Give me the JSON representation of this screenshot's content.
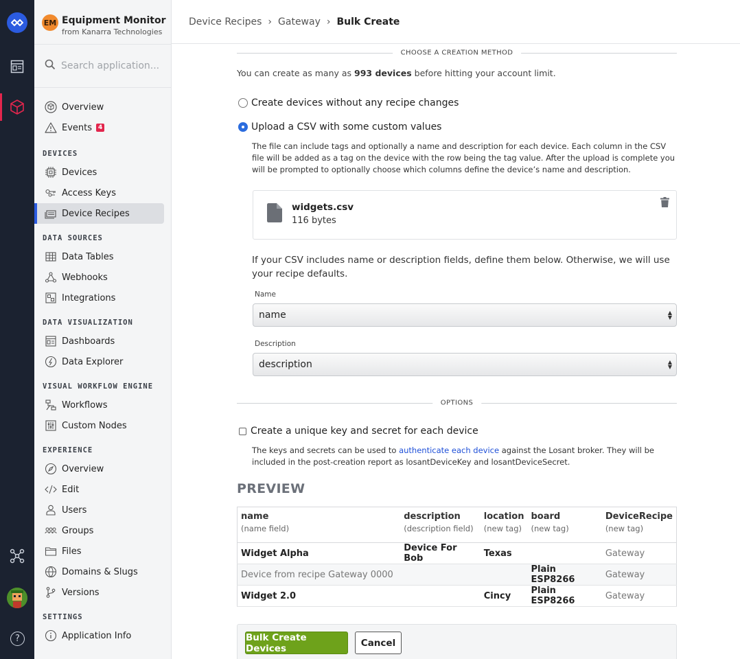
{
  "colors": {
    "rail_bg": "#1b2230",
    "accent_blue": "#2b5be0",
    "alert_red": "#e2264d",
    "primary_green": "#6ea21b",
    "app_badge": "#f18a2d"
  },
  "rail": {
    "icons": [
      "losant-logo-icon",
      "dashboard-icon",
      "cube-icon",
      "workflow-nodes-icon",
      "user-avatar",
      "help-icon"
    ],
    "help_glyph": "?"
  },
  "app": {
    "initials": "EM",
    "name": "Equipment Monitor",
    "org": "from Kanarra Technologies"
  },
  "search": {
    "placeholder": "Search application..."
  },
  "nav": {
    "top": [
      {
        "label": "Overview",
        "icon": "cube-outline-icon"
      },
      {
        "label": "Events",
        "icon": "warning-icon",
        "badge": "4"
      }
    ],
    "devices": {
      "title": "DEVICES",
      "items": [
        {
          "label": "Devices",
          "icon": "chip-icon"
        },
        {
          "label": "Access Keys",
          "icon": "keys-icon"
        },
        {
          "label": "Device Recipes",
          "icon": "recipe-icon",
          "active": true
        }
      ]
    },
    "data_sources": {
      "title": "DATA SOURCES",
      "items": [
        {
          "label": "Data Tables",
          "icon": "table-icon"
        },
        {
          "label": "Webhooks",
          "icon": "webhook-icon"
        },
        {
          "label": "Integrations",
          "icon": "integrations-icon"
        }
      ]
    },
    "data_viz": {
      "title": "DATA VISUALIZATION",
      "items": [
        {
          "label": "Dashboards",
          "icon": "dashboard-icon"
        },
        {
          "label": "Data Explorer",
          "icon": "explorer-icon"
        }
      ]
    },
    "workflow": {
      "title": "VISUAL WORKFLOW ENGINE",
      "items": [
        {
          "label": "Workflows",
          "icon": "workflow-icon"
        },
        {
          "label": "Custom Nodes",
          "icon": "sliders-icon"
        }
      ]
    },
    "experience": {
      "title": "EXPERIENCE",
      "items": [
        {
          "label": "Overview",
          "icon": "compass-icon"
        },
        {
          "label": "Edit",
          "icon": "code-edit-icon"
        },
        {
          "label": "Users",
          "icon": "user-icon"
        },
        {
          "label": "Groups",
          "icon": "groups-icon"
        },
        {
          "label": "Files",
          "icon": "folder-icon"
        },
        {
          "label": "Domains & Slugs",
          "icon": "globe-icon"
        },
        {
          "label": "Versions",
          "icon": "branch-icon"
        }
      ]
    },
    "settings": {
      "title": "SETTINGS",
      "items": [
        {
          "label": "Application Info",
          "icon": "info-icon"
        }
      ]
    }
  },
  "breadcrumb": {
    "items": [
      "Device Recipes",
      "Gateway"
    ],
    "current": "Bulk Create",
    "separator": "›"
  },
  "method": {
    "section_title": "CHOOSE A CREATION METHOD",
    "limit_prefix": "You can create as many as ",
    "limit_value": "993 devices",
    "limit_suffix": " before hitting your account limit.",
    "option_none": "Create devices without any recipe changes",
    "option_csv": "Upload a CSV with some custom values",
    "selected": "csv",
    "csv_help": "The file can include tags and optionally a name and description for each device. Each column in the CSV file will be added as a tag on the device with the row being the tag value. After the upload is complete you will be prompted to optionally choose which columns define the device’s name and description."
  },
  "file": {
    "name": "widgets.csv",
    "size": "116 bytes"
  },
  "mapping": {
    "info": "If your CSV includes name or description fields, define them below. Otherwise, we will use your recipe defaults.",
    "name_label": "Name",
    "name_value": "name",
    "description_label": "Description",
    "description_value": "description"
  },
  "options": {
    "section_title": "OPTIONS",
    "unique_key_label": "Create a unique key and secret for each device",
    "unique_key_checked": false,
    "help_prefix": "The keys and secrets can be used to ",
    "help_link": "authenticate each device",
    "help_suffix": " against the Losant broker. They will be included in the post-creation report as losantDeviceKey and losantDeviceSecret."
  },
  "preview": {
    "title": "PREVIEW",
    "columns": [
      {
        "name": "name",
        "sub": "(name field)"
      },
      {
        "name": "description",
        "sub": "(description field)"
      },
      {
        "name": "location",
        "sub": "(new tag)"
      },
      {
        "name": "board",
        "sub": "(new tag)"
      },
      {
        "name": "DeviceRecipe",
        "sub": "(new tag)"
      }
    ],
    "rows": [
      [
        "Widget Alpha",
        "Device For Bob",
        "Texas",
        "",
        "Gateway"
      ],
      [
        "Device from recipe Gateway 0000",
        "",
        "",
        "Plain ESP8266",
        "Gateway"
      ],
      [
        "Widget 2.0",
        "",
        "Cincy",
        "Plain ESP8266",
        "Gateway"
      ]
    ]
  },
  "actions": {
    "primary": "Bulk Create Devices",
    "cancel": "Cancel"
  }
}
